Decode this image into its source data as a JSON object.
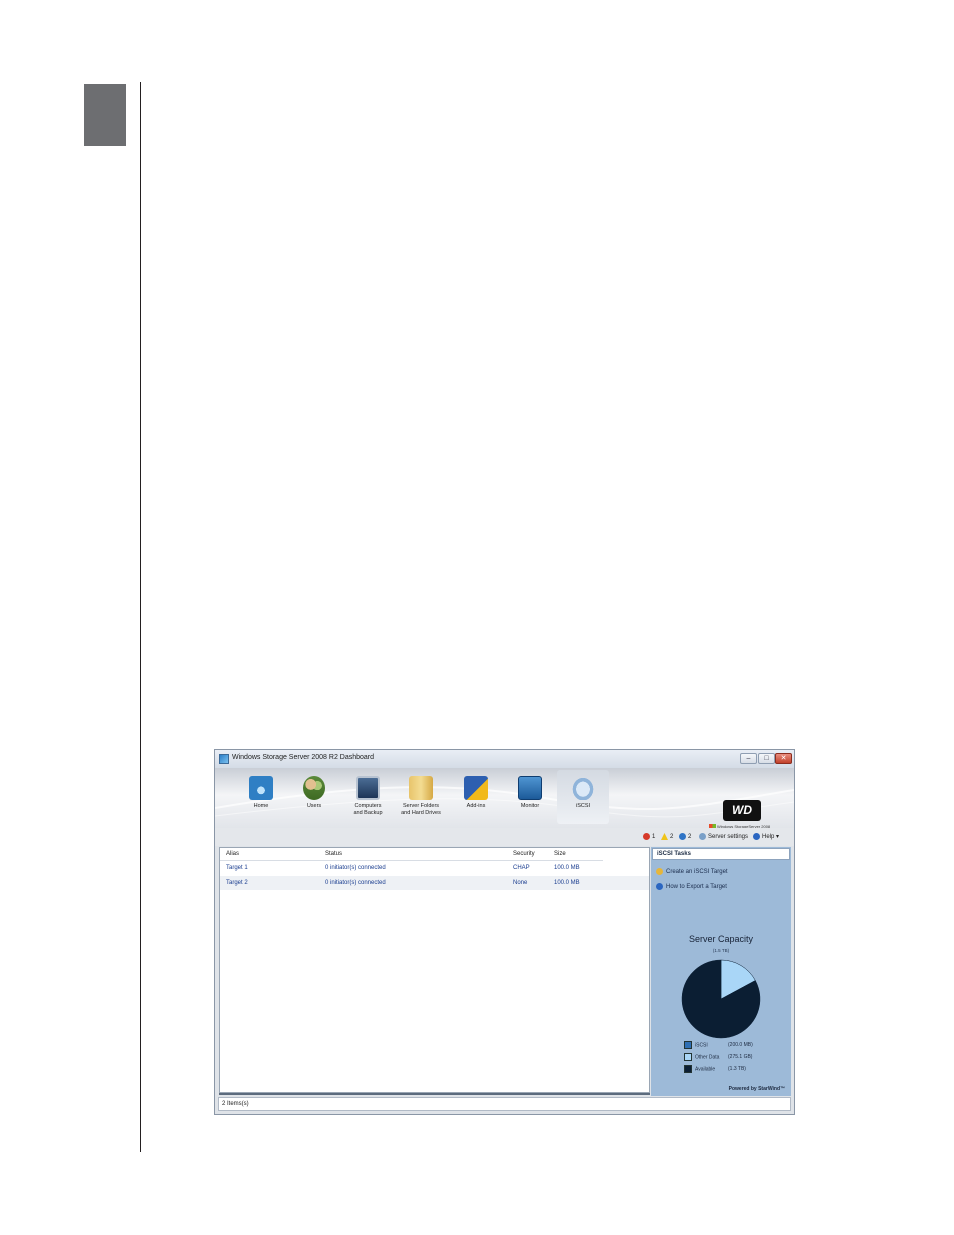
{
  "window": {
    "title": "Windows Storage Server 2008 R2 Dashboard",
    "min_glyph": "–",
    "max_glyph": "□",
    "close_glyph": "✕"
  },
  "nav": {
    "items": [
      {
        "label": "Home",
        "icon": "home-icon"
      },
      {
        "label": "Users",
        "icon": "users-icon"
      },
      {
        "label": "Computers\nand Backup",
        "icon": "computer-icon"
      },
      {
        "label": "Server Folders\nand Hard Drives",
        "icon": "folder-icon"
      },
      {
        "label": "Add-ins",
        "icon": "addin-icon"
      },
      {
        "label": "Monitor",
        "icon": "monitor-icon"
      },
      {
        "label": "iSCSI",
        "icon": "iscsi-icon"
      }
    ],
    "active": "iSCSI"
  },
  "brand": {
    "logo_text": "WD",
    "wss_text": "Windows StorageServer 2008"
  },
  "alerts": {
    "errors": "1",
    "warnings": "2",
    "info": "2",
    "server_settings": "Server settings",
    "help": "Help",
    "help_caret": "▾"
  },
  "table": {
    "columns": [
      "Alias",
      "Status",
      "Security",
      "Size"
    ],
    "rows": [
      {
        "alias": "Target 1",
        "status": "0 initiator(s) connected",
        "security": "CHAP",
        "size": "100.0 MB"
      },
      {
        "alias": "Target 2",
        "status": "0 initiator(s) connected",
        "security": "None",
        "size": "100.0 MB"
      }
    ]
  },
  "tasks": {
    "heading": "iSCSI Tasks",
    "items": [
      "Create an iSCSI Target",
      "How to Export a Target"
    ]
  },
  "capacity": {
    "title": "Server Capacity",
    "subtitle": "(1.5 TB)",
    "legend": [
      {
        "label": "iSCSI",
        "value": "(200.0 MB)",
        "color": "#2f6fb3"
      },
      {
        "label": "Other Data",
        "value": "(275.1 GB)",
        "color": "#a9d6f7"
      },
      {
        "label": "Available",
        "value": "(1.3 TB)",
        "color": "#0b1e33"
      }
    ],
    "powered_by": "Powered by StarWind™"
  },
  "chart_data": {
    "type": "pie",
    "title": "Server Capacity",
    "subtitle": "(1.5 TB)",
    "slices": [
      {
        "label": "iSCSI",
        "value": 200.0,
        "unit": "MB",
        "color": "#2f6fb3"
      },
      {
        "label": "Other Data",
        "value": 275.1,
        "unit": "GB",
        "color": "#a9d6f7"
      },
      {
        "label": "Available",
        "value": 1.3,
        "unit": "TB",
        "color": "#0b1e33"
      }
    ],
    "legend": "below"
  },
  "statusbar": {
    "text": "2 Items(s)"
  },
  "colors": {
    "accent": "#1a3d8f",
    "task_pane": "#9dbad8",
    "chapter_tab": "#6d6e71"
  }
}
